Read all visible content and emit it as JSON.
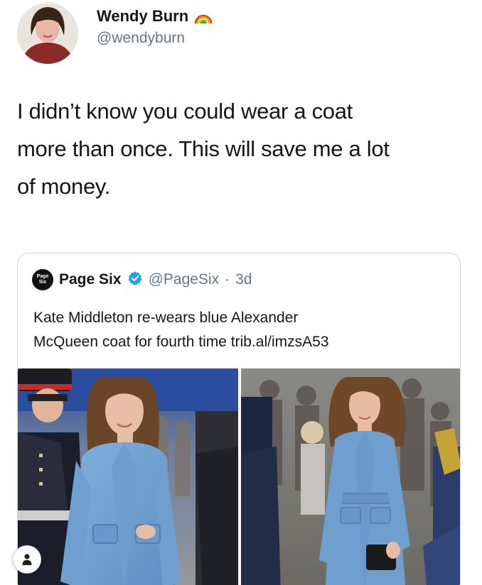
{
  "tweet": {
    "author_name": "Wendy Burn",
    "author_handle": "@wendyburn",
    "text_lines": [
      "I didn’t know you could wear a coat",
      "more than once. This will save me a lot",
      "of money."
    ]
  },
  "quoted_tweet": {
    "logo_text_top": "Page",
    "logo_text_bottom": "Six",
    "name": "Page Six",
    "handle": "@PageSix",
    "separator": "·",
    "age": "3d",
    "text_lines": [
      "Kate Middleton re-wears blue Alexander",
      "McQueen coat for fourth time trib.al/imzsA53"
    ]
  },
  "icons": {
    "rainbow": "rainbow-emoji-icon",
    "verified": "verified-badge-icon",
    "user": "user-icon"
  },
  "colors": {
    "text": "#14171a",
    "secondary_text": "#657786",
    "verified_blue": "#1da1f2",
    "coat_blue": "#6f9fcf"
  }
}
